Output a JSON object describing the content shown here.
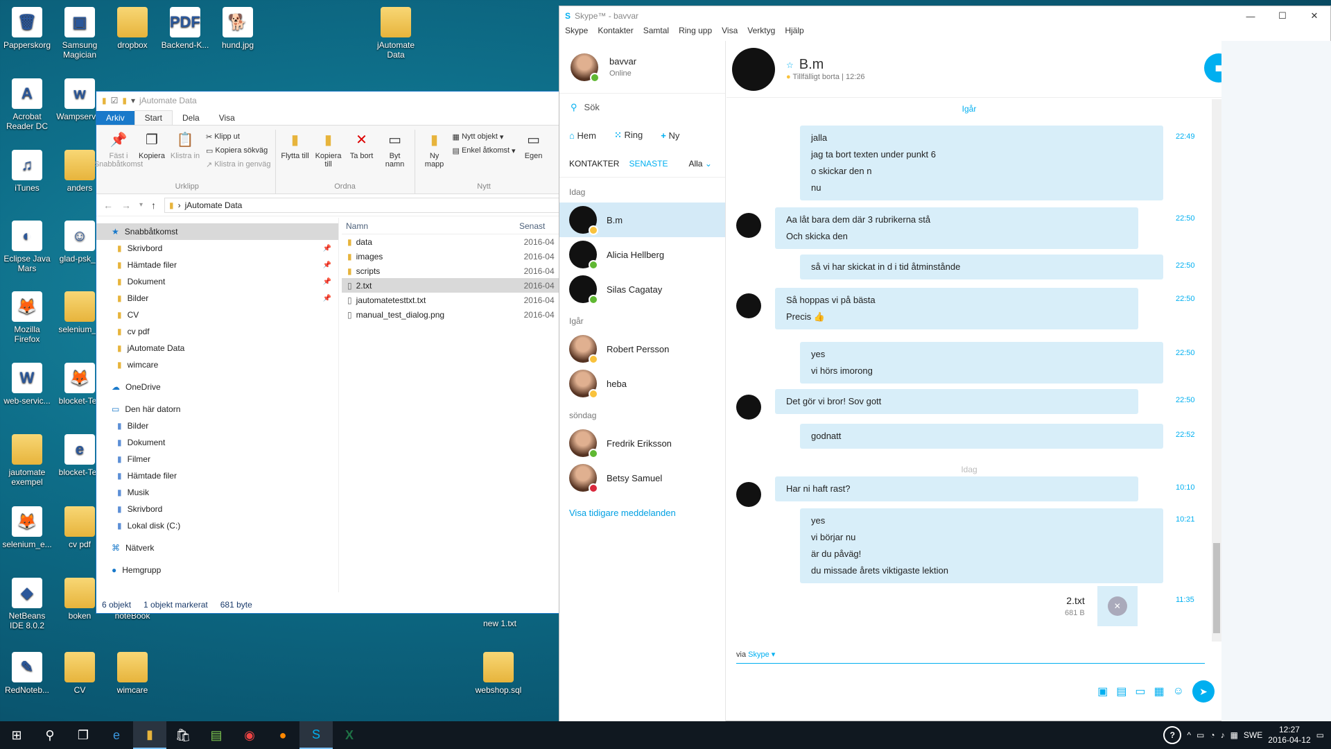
{
  "desktop": {
    "icons": [
      {
        "label": "Papperskorg",
        "glyph": "🗑"
      },
      {
        "label": "Samsung Magician",
        "glyph": "▣"
      },
      {
        "label": "dropbox",
        "glyph": ""
      },
      {
        "label": "Backend-K...",
        "glyph": "PDF"
      },
      {
        "label": "hund.jpg",
        "glyph": "🐕"
      },
      {
        "label": "jAutomate Data",
        "glyph": ""
      },
      {
        "label": "Acrobat Reader DC",
        "glyph": "A"
      },
      {
        "label": "Wampserver",
        "glyph": "w"
      },
      {
        "label": "iTunes",
        "glyph": "♫"
      },
      {
        "label": "anders",
        "glyph": ""
      },
      {
        "label": "Eclipse Java Mars",
        "glyph": "◐"
      },
      {
        "label": "glad-psk_1",
        "glyph": "☺"
      },
      {
        "label": "Mozilla Firefox",
        "glyph": "🦊"
      },
      {
        "label": "selenium_e",
        "glyph": ""
      },
      {
        "label": "web-servic...",
        "glyph": "W"
      },
      {
        "label": "blocket-Tes",
        "glyph": "🦊"
      },
      {
        "label": "jautomate exempel",
        "glyph": ""
      },
      {
        "label": "blocket-Tes",
        "glyph": "e"
      },
      {
        "label": "selenium_e...",
        "glyph": "🦊"
      },
      {
        "label": "cv pdf",
        "glyph": ""
      },
      {
        "label": "NetBeans IDE 8.0.2",
        "glyph": "◆"
      },
      {
        "label": "boken",
        "glyph": ""
      },
      {
        "label": "noteBook",
        "glyph": ""
      },
      {
        "label": "new 1.txt",
        "glyph": ""
      },
      {
        "label": "RedNoteb...",
        "glyph": "✎"
      },
      {
        "label": "CV",
        "glyph": ""
      },
      {
        "label": "wimcare",
        "glyph": ""
      },
      {
        "label": "webshop.sql",
        "glyph": ""
      }
    ]
  },
  "explorer": {
    "title": "jAutomate Data",
    "tabs": [
      "Arkiv",
      "Start",
      "Dela",
      "Visa"
    ],
    "ribbon": {
      "pin": "Fäst i Snabbåtkomst",
      "copy": "Kopiera",
      "paste": "Klistra in",
      "cut": "Klipp ut",
      "copypath": "Kopiera sökväg",
      "pasteshortcut": "Klistra in genväg",
      "group1": "Urklipp",
      "move": "Flytta till",
      "copyto": "Kopiera till",
      "delete": "Ta bort",
      "rename": "Byt namn",
      "group2": "Ordna",
      "newfolder": "Ny mapp",
      "newitem": "Nytt objekt",
      "easyaccess": "Enkel åtkomst",
      "group3": "Nytt",
      "props": "Egen"
    },
    "path": "jAutomate Data",
    "nav": {
      "quick": "Snabbåtkomst",
      "quick_items": [
        "Skrivbord",
        "Hämtade filer",
        "Dokument",
        "Bilder",
        "CV",
        "cv pdf",
        "jAutomate Data",
        "wimcare"
      ],
      "onedrive": "OneDrive",
      "pc": "Den här datorn",
      "pc_items": [
        "Bilder",
        "Dokument",
        "Filmer",
        "Hämtade filer",
        "Musik",
        "Skrivbord",
        "Lokal disk (C:)"
      ],
      "network": "Nätverk",
      "homegroup": "Hemgrupp"
    },
    "columns": {
      "name": "Namn",
      "date": "Senast"
    },
    "files": [
      {
        "name": "data",
        "date": "2016-04"
      },
      {
        "name": "images",
        "date": "2016-04"
      },
      {
        "name": "scripts",
        "date": "2016-04"
      },
      {
        "name": "2.txt",
        "date": "2016-04"
      },
      {
        "name": "jautomatetesttxt.txt",
        "date": "2016-04"
      },
      {
        "name": "manual_test_dialog.png",
        "date": "2016-04"
      }
    ],
    "status": {
      "count": "6 objekt",
      "selected": "1 objekt markerat",
      "size": "681 byte"
    }
  },
  "skype": {
    "title": "Skype™ - bavvar",
    "menu": [
      "Skype",
      "Kontakter",
      "Samtal",
      "Ring upp",
      "Visa",
      "Verktyg",
      "Hjälp"
    ],
    "me": {
      "name": "bavvar",
      "status": "Online"
    },
    "search": "Sök",
    "nav": {
      "home": "Hem",
      "call": "Ring",
      "new": "Ny"
    },
    "tabs": {
      "contacts": "KONTAKTER",
      "recent": "SENASTE",
      "filter": "Alla"
    },
    "groups": [
      {
        "label": "Idag",
        "contacts": [
          {
            "name": "B.m",
            "status": "away"
          },
          {
            "name": "Alicia Hellberg",
            "status": "on"
          },
          {
            "name": "Silas Cagatay",
            "status": "on"
          }
        ]
      },
      {
        "label": "Igår",
        "contacts": [
          {
            "name": "Robert Persson",
            "status": "away"
          },
          {
            "name": "heba",
            "status": "away"
          }
        ]
      },
      {
        "label": "söndag",
        "contacts": [
          {
            "name": "Fredrik Eriksson",
            "status": "on"
          },
          {
            "name": "Betsy Samuel",
            "status": "busy"
          }
        ]
      }
    ],
    "show_older": "Visa tidigare meddelanden",
    "chat": {
      "name": "B.m",
      "status": "Tillfälligt borta",
      "time": "12:26",
      "sep_yesterday": "Igår",
      "sep_today": "Idag",
      "messages": [
        {
          "lines": [
            "jalla",
            "jag ta bort texten under punkt 6",
            "o skickar den n",
            "nu"
          ],
          "time": "22:49"
        },
        {
          "lines": [
            "Aa låt bara dem där 3 rubrikerna stå",
            "Och skicka den"
          ],
          "time": "22:50"
        },
        {
          "lines": [
            "så vi har skickat in d i tid åtminstånde"
          ],
          "time": "22:50"
        },
        {
          "lines": [
            "Så hoppas vi på bästa",
            "Precis 👍"
          ],
          "time": "22:50"
        },
        {
          "lines": [
            "yes",
            "vi hörs imorong"
          ],
          "time": "22:50"
        },
        {
          "lines": [
            "Det gör vi bror! Sov gott"
          ],
          "time": "22:50"
        },
        {
          "lines": [
            "godnatt"
          ],
          "time": "22:52"
        },
        {
          "lines": [
            "Har ni haft rast?"
          ],
          "time": "10:10"
        },
        {
          "lines": [
            "yes",
            "vi börjar nu",
            "är du påväg!",
            "du missade årets viktigaste lektion"
          ],
          "time": "10:21"
        }
      ],
      "file": {
        "name": "2.txt",
        "size": "681 B",
        "time": "11:35"
      },
      "via": "via",
      "via_link": "Skype"
    }
  },
  "tray": {
    "lang": "SWE",
    "time": "12:27",
    "date": "2016-04-12"
  }
}
